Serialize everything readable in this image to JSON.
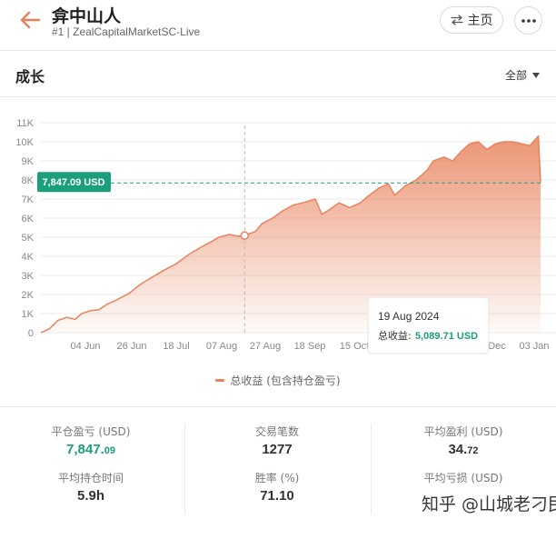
{
  "header": {
    "title": "弇中山人",
    "subtitle": "#1 | ZealCapitalMarketSC-Live",
    "home_label": "主页"
  },
  "colors": {
    "accent": "#e8825c",
    "green": "#1a9e7c",
    "grid": "#ebebeb"
  },
  "icons": {
    "back": "arrow-left-icon",
    "home": "swap-icon",
    "more": "more-horizontal-icon"
  },
  "section": {
    "title": "成长",
    "range_label": "全部"
  },
  "chart_data": {
    "type": "area",
    "series": [
      {
        "name": "总收益 (包含持仓盈亏)"
      }
    ],
    "x": [
      "2024-05-16",
      "2024-05-20",
      "2024-05-24",
      "2024-05-28",
      "2024-06-01",
      "2024-06-04",
      "2024-06-08",
      "2024-06-12",
      "2024-06-16",
      "2024-06-20",
      "2024-06-26",
      "2024-07-01",
      "2024-07-06",
      "2024-07-12",
      "2024-07-18",
      "2024-07-24",
      "2024-07-30",
      "2024-08-04",
      "2024-08-07",
      "2024-08-12",
      "2024-08-16",
      "2024-08-19",
      "2024-08-24",
      "2024-08-27",
      "2024-09-01",
      "2024-09-06",
      "2024-09-11",
      "2024-09-15",
      "2024-09-18",
      "2024-09-21",
      "2024-09-24",
      "2024-09-27",
      "2024-10-02",
      "2024-10-07",
      "2024-10-12",
      "2024-10-15",
      "2024-10-21",
      "2024-10-25",
      "2024-10-28",
      "2024-11-02",
      "2024-11-07",
      "2024-11-12",
      "2024-11-15",
      "2024-11-20",
      "2024-11-24",
      "2024-11-28",
      "2024-12-02",
      "2024-12-06",
      "2024-12-10",
      "2024-12-14",
      "2024-12-18",
      "2024-12-22",
      "2024-12-26",
      "2024-12-30",
      "2025-01-03",
      "2025-01-04"
    ],
    "values": [
      0,
      200,
      650,
      800,
      700,
      1000,
      1150,
      1200,
      1500,
      1700,
      2050,
      2500,
      2850,
      3250,
      3600,
      4100,
      4500,
      4800,
      5000,
      5150,
      5050,
      5090,
      5300,
      5700,
      6000,
      6400,
      6700,
      6800,
      6900,
      7000,
      6200,
      6400,
      6800,
      6550,
      6800,
      7100,
      7600,
      7800,
      7200,
      7700,
      8000,
      8500,
      9000,
      9200,
      9000,
      9500,
      9900,
      10000,
      9600,
      9900,
      10000,
      10000,
      9900,
      9800,
      10300,
      7847
    ],
    "xticks": [
      "04 Jun",
      "26 Jun",
      "18 Jul",
      "07 Aug",
      "27 Aug",
      "18 Sep",
      "15 Oct",
      "Dec",
      "03 Jan"
    ],
    "yticks": [
      "0",
      "1K",
      "2K",
      "3K",
      "4K",
      "5K",
      "6K",
      "7K",
      "8K",
      "9K",
      "10K",
      "11K"
    ],
    "ylim": [
      0,
      11000
    ],
    "current_label": "7,847.09 USD",
    "current_value": 7847.09,
    "hover": {
      "date": "2024-08-19",
      "title": "19 Aug 2024",
      "label": "总收益:",
      "value": "5,089.71 USD",
      "value_num": 5089.71
    },
    "legend_position": "bottom",
    "grid": "horizontal"
  },
  "stats": {
    "closed_pnl": {
      "label": "平仓盈亏 (USD)",
      "int": "7,847.",
      "dec": "09"
    },
    "trades": {
      "label": "交易笔数",
      "value": "1277"
    },
    "avg_profit": {
      "label": "平均盈利 (USD)",
      "int": "34.",
      "dec": "72"
    },
    "avg_hold": {
      "label": "平均持仓时间",
      "value": "5.9h"
    },
    "win_rate": {
      "label": "胜率 (%)",
      "value": "71.10"
    },
    "avg_loss": {
      "label": "平均亏损 (USD)"
    }
  },
  "watermark": "知乎 @山城老刁民"
}
